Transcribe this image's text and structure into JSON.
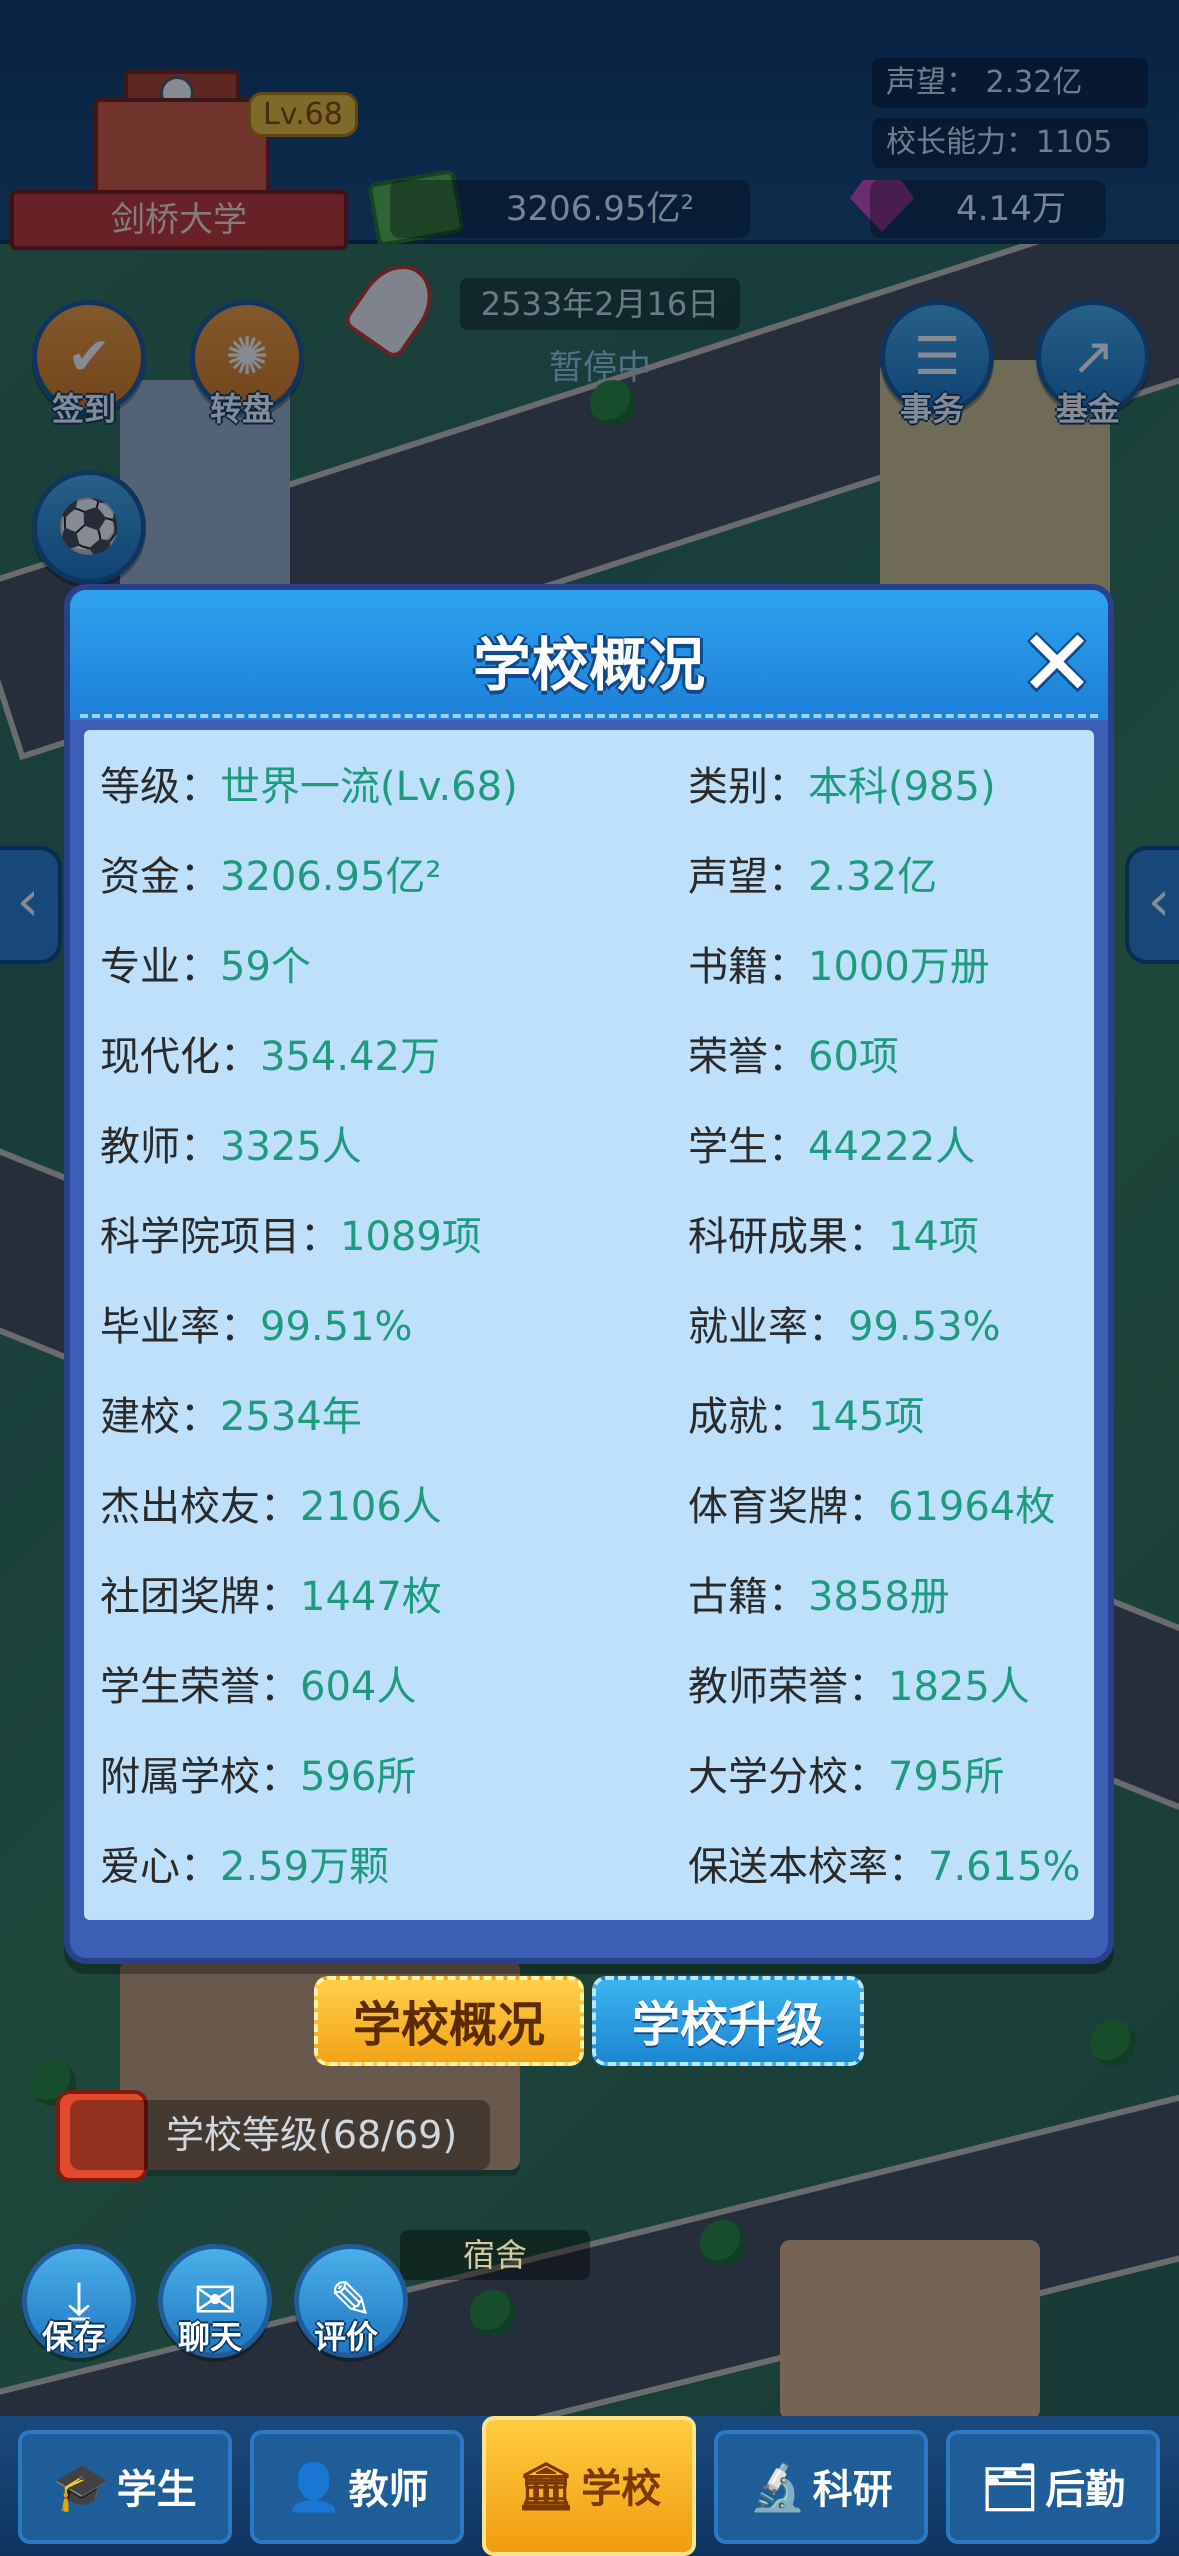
{
  "header": {
    "school_name": "剑桥大学",
    "level_badge": "Lv.68",
    "money": "3206.95亿²",
    "gems": "4.14万",
    "reputation": "声望：  2.32亿",
    "principal_ability": "校长能力：1105",
    "date": "2533年2月16日",
    "status": "暂停中"
  },
  "left_buttons": [
    {
      "label": "签到",
      "icon": "checkin-icon"
    },
    {
      "label": "转盘",
      "icon": "wheel-icon"
    },
    {
      "label": "球",
      "icon": "football-icon"
    }
  ],
  "right_buttons": [
    {
      "label": "事务",
      "icon": "clipboard-icon"
    },
    {
      "label": "基金",
      "icon": "chart-icon"
    }
  ],
  "modal": {
    "title": "学校概况",
    "close_icon": "close-icon",
    "rows": [
      {
        "left_key": "等级：",
        "left_val": "世界一流(Lv.68)",
        "right_key": "类别：",
        "right_val": "本科(985)"
      },
      {
        "left_key": "资金：",
        "left_val": "3206.95亿²",
        "right_key": "声望：",
        "right_val": "2.32亿"
      },
      {
        "left_key": "专业：",
        "left_val": "59个",
        "right_key": "书籍：",
        "right_val": "1000万册"
      },
      {
        "left_key": "现代化：",
        "left_val": "354.42万",
        "right_key": "荣誉：",
        "right_val": "60项"
      },
      {
        "left_key": "教师：",
        "left_val": "3325人",
        "right_key": "学生：",
        "right_val": "44222人"
      },
      {
        "left_key": "科学院项目：",
        "left_val": "1089项",
        "right_key": "科研成果：",
        "right_val": "14项"
      },
      {
        "left_key": "毕业率：",
        "left_val": "99.51%",
        "right_key": "就业率：",
        "right_val": "99.53%"
      },
      {
        "left_key": "建校：",
        "left_val": "2534年",
        "right_key": "成就：",
        "right_val": "145项"
      },
      {
        "left_key": "杰出校友：",
        "left_val": "2106人",
        "right_key": "体育奖牌：",
        "right_val": "61964枚"
      },
      {
        "left_key": "社团奖牌：",
        "left_val": "1447枚",
        "right_key": "古籍：",
        "right_val": "3858册"
      },
      {
        "left_key": "学生荣誉：",
        "left_val": "604人",
        "right_key": "教师荣誉：",
        "right_val": "1825人"
      },
      {
        "left_key": "附属学校：",
        "left_val": "596所",
        "right_key": "大学分校：",
        "right_val": "795所"
      },
      {
        "left_key": "爱心：",
        "left_val": "2.59万颗",
        "right_key": "保送本校率：",
        "right_val": "7.615%"
      }
    ]
  },
  "tabs": {
    "overview": "学校概况",
    "upgrade": "学校升级"
  },
  "school_level": "学校等级(68/69)",
  "dorm_label": "宿舍",
  "bottom_left_buttons": [
    {
      "label": "保存",
      "icon": "save-icon"
    },
    {
      "label": "聊天",
      "icon": "chat-icon"
    },
    {
      "label": "评价",
      "icon": "review-icon"
    }
  ],
  "bottom_nav": [
    {
      "label": "学生",
      "icon": "student-icon"
    },
    {
      "label": "教师",
      "icon": "teacher-icon"
    },
    {
      "label": "学校",
      "icon": "school-icon"
    },
    {
      "label": "科研",
      "icon": "research-icon"
    },
    {
      "label": "后勤",
      "icon": "logistics-icon"
    }
  ],
  "colors": {
    "accent": "#1c7fd6",
    "value_green": "#1e9a7e",
    "active_tab": "#f3a317"
  }
}
